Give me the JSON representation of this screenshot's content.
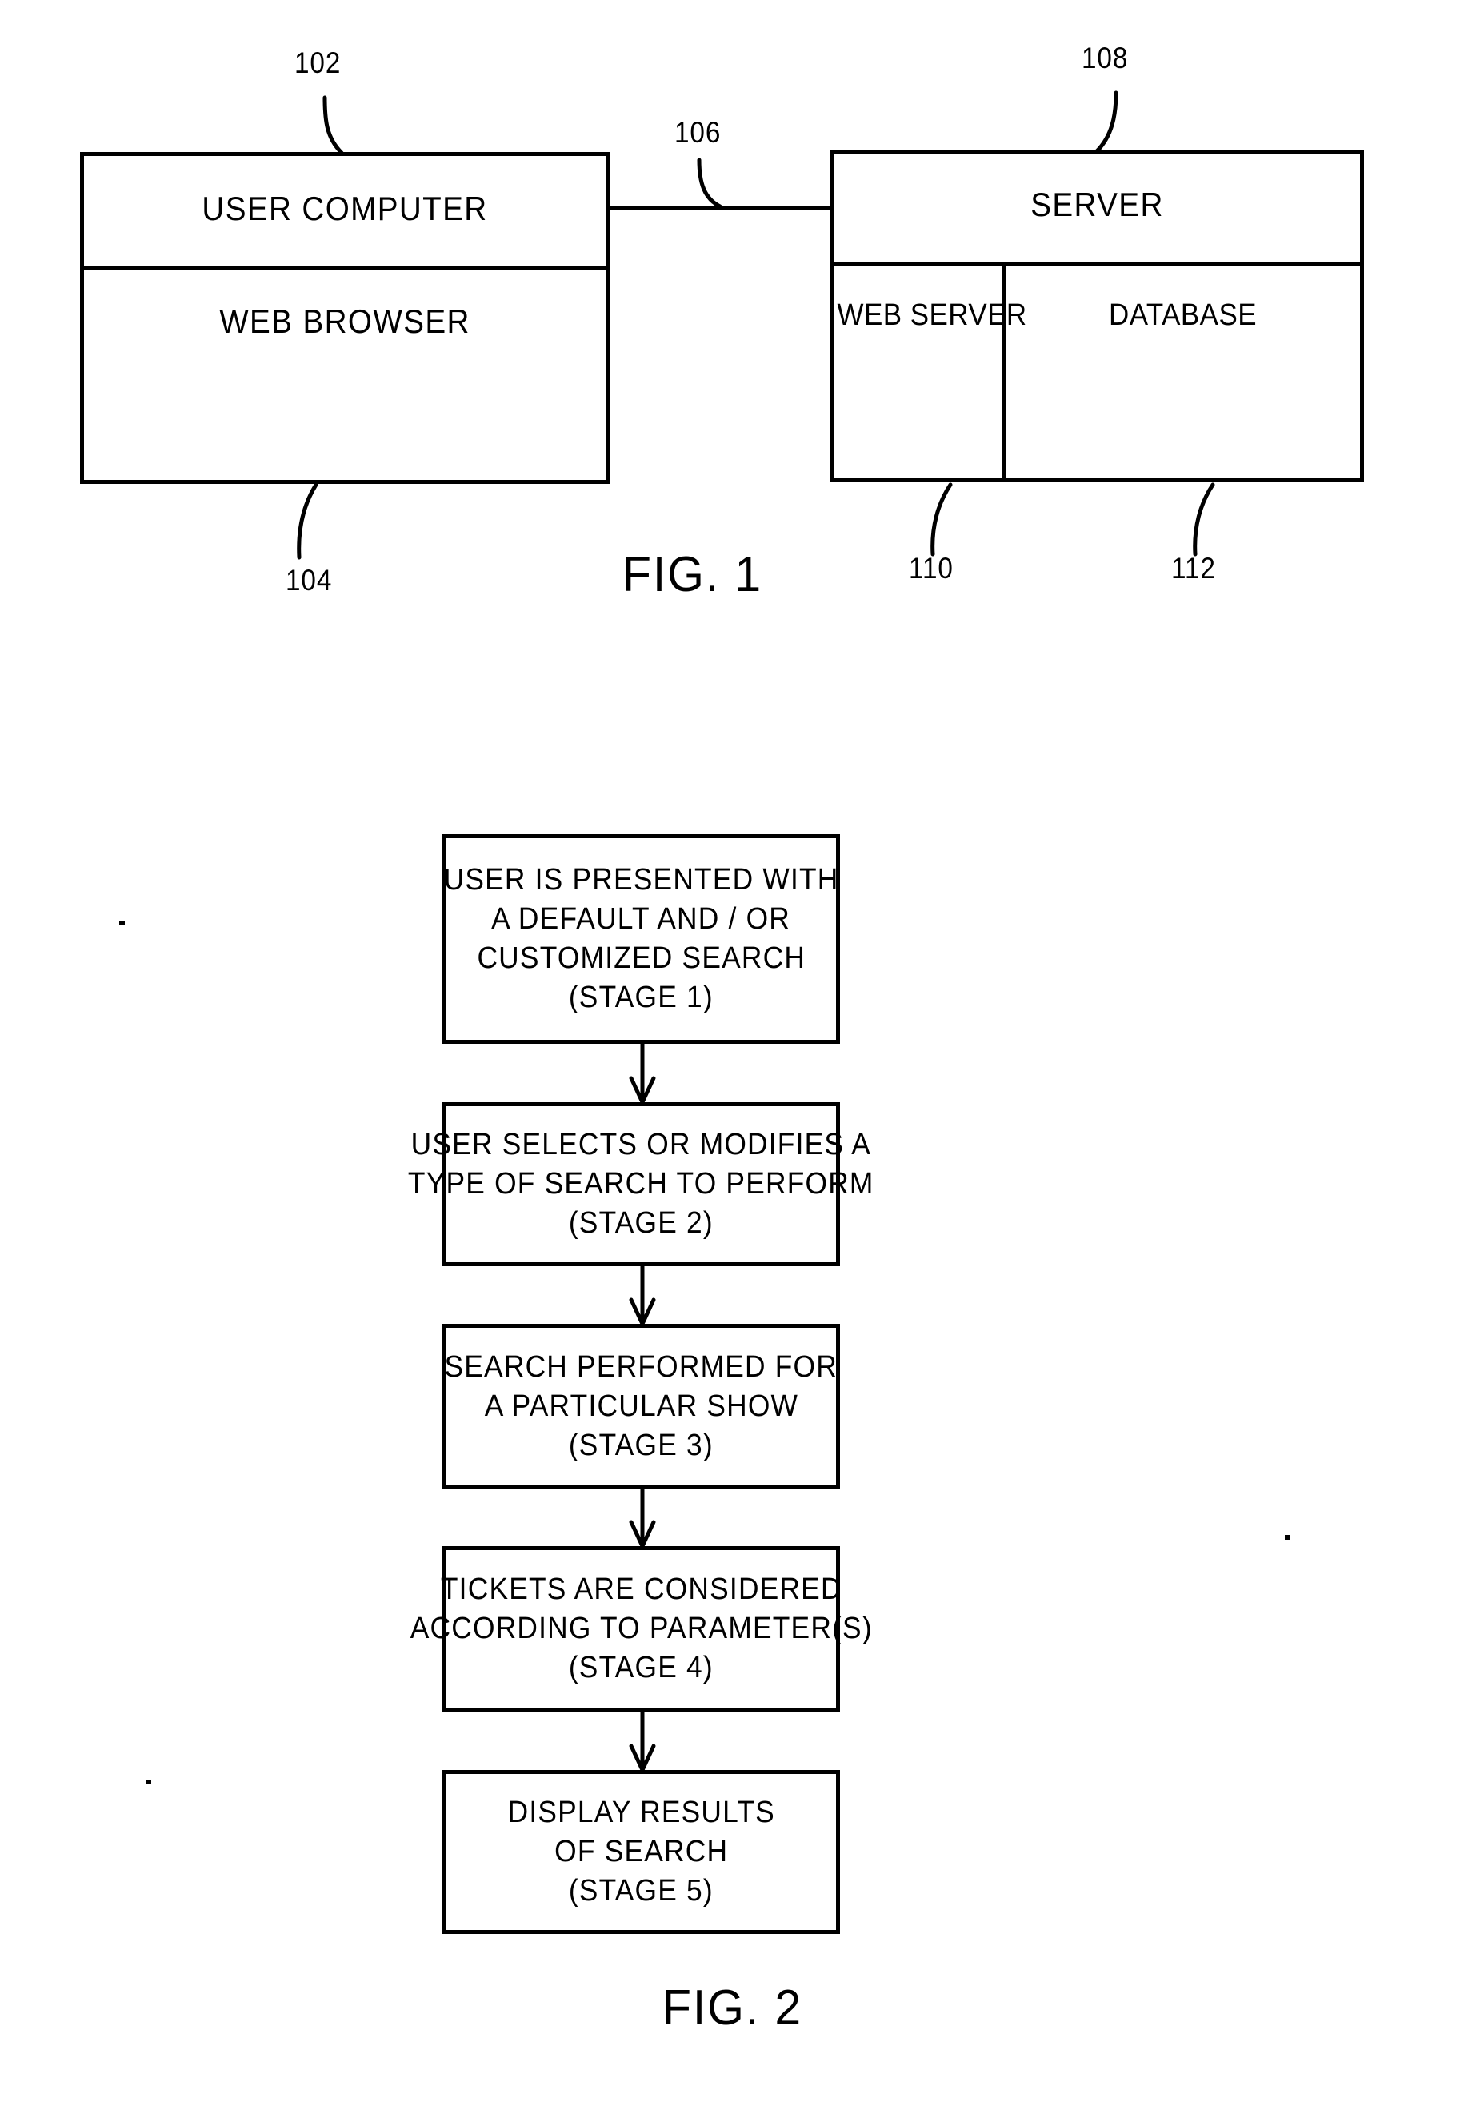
{
  "page": {
    "background": "#ffffff",
    "ink": "#000000"
  },
  "figure1": {
    "caption": "FIG. 1",
    "user_computer_box": {
      "title": "USER COMPUTER",
      "subsystem": "WEB BROWSER",
      "ref_title": "102",
      "ref_subsystem": "104"
    },
    "server_box": {
      "title": "SERVER",
      "subsystems": [
        {
          "label": "WEB SERVER",
          "ref": "110"
        },
        {
          "label": "DATABASE",
          "ref": "112"
        }
      ],
      "ref_title": "108"
    },
    "network_link": {
      "ref": "106"
    }
  },
  "figure2": {
    "caption": "FIG. 2",
    "stages": [
      {
        "lines": [
          "USER IS PRESENTED WITH",
          "A DEFAULT AND / OR",
          "CUSTOMIZED SEARCH",
          "(STAGE 1)"
        ]
      },
      {
        "lines": [
          "USER SELECTS OR MODIFIES A",
          "TYPE OF SEARCH  TO PERFORM",
          "(STAGE 2)"
        ]
      },
      {
        "lines": [
          "SEARCH  PERFORMED  FOR",
          "A PARTICULAR SHOW",
          "(STAGE 3)"
        ]
      },
      {
        "lines": [
          "TICKETS ARE CONSIDERED",
          "ACCORDING  TO PARAMETER(S)",
          "(STAGE 4)"
        ]
      },
      {
        "lines": [
          "DISPLAY RESULTS",
          "OF SEARCH",
          "(STAGE 5)"
        ]
      }
    ]
  }
}
